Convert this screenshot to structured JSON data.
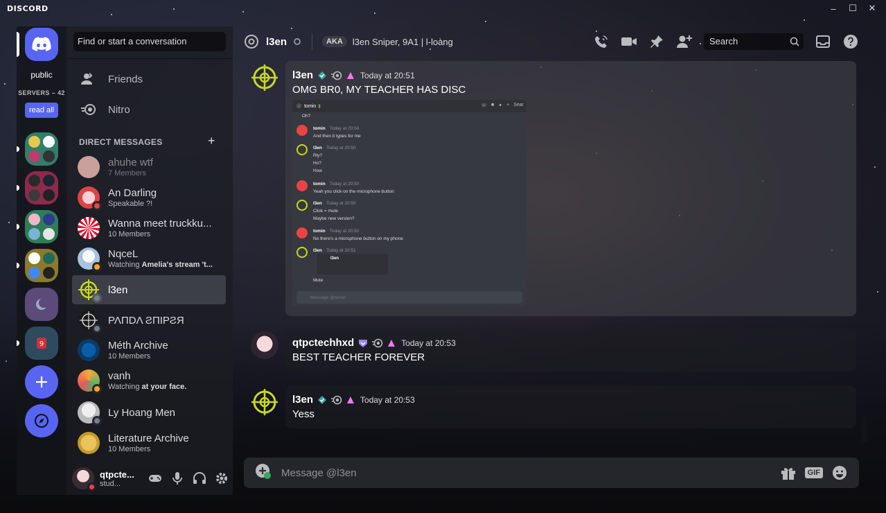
{
  "app": {
    "brand": "DISCORD"
  },
  "rail": {
    "home_label": "public",
    "servers_label": "SERVERS – 42",
    "read_all": "read all"
  },
  "dm_sidebar": {
    "search_placeholder": "Find or start a conversation",
    "nav": [
      {
        "label": "Friends"
      },
      {
        "label": "Nitro"
      }
    ],
    "header": "DIRECT MESSAGES",
    "items": [
      {
        "name": "ahuhe wtf",
        "sub": "7 Members"
      },
      {
        "name": "An Darling",
        "sub": "Speakable ?!"
      },
      {
        "name": "Wanna meet truckku...",
        "sub": "10 Members"
      },
      {
        "name": "NqceL",
        "sub_prefix": "Watching ",
        "sub_bold": "Amelia's stream 't..."
      },
      {
        "name": "l3en",
        "sub": ""
      },
      {
        "name": "ΡΛΠDΛ ƧПIΡƧЯ",
        "sub": ""
      },
      {
        "name": "Méth Archive",
        "sub": "10 Members"
      },
      {
        "name": "vanh",
        "sub_prefix": "Watching ",
        "sub_bold": "at your face."
      },
      {
        "name": "Ly Hoang Men",
        "sub": ""
      },
      {
        "name": "Literature Archive",
        "sub": "10 Members"
      }
    ]
  },
  "user_panel": {
    "name": "qtpcte...",
    "status": "stud..."
  },
  "channel": {
    "name": "l3en",
    "aka_badge": "AKA",
    "aka_text": "l3en Sniper, 9A1 | l-loàng",
    "search_placeholder": "Search"
  },
  "messages": [
    {
      "author": "l3en",
      "time": "Today at 20:51",
      "text": "OMG BR0, MY TEACHER HAS DISC"
    },
    {
      "author": "qtpctechhxd",
      "time": "Today at 20:53",
      "text": "BEST TEACHER FOREVER"
    },
    {
      "author": "l3en",
      "time": "Today at 20:53",
      "text": "Yess"
    }
  ],
  "embed": {
    "header_name": "tomin",
    "header_search": "Sear",
    "lines": [
      {
        "author": "",
        "time": "",
        "texts": [
          "Oh?"
        ]
      },
      {
        "author": "tomin",
        "time": "Today at 20:50",
        "texts": [
          "And then it types for me"
        ]
      },
      {
        "author": "l3en",
        "time": "Today at 20:50",
        "texts": [
          "Rly?",
          "Ho?",
          "How"
        ]
      },
      {
        "author": "tomin",
        "time": "Today at 20:50",
        "texts": [
          "Yeah you click on the microphone button"
        ]
      },
      {
        "author": "l3en",
        "time": "Today at 20:50",
        "texts": [
          "Click = mute",
          "Maybe new version?"
        ]
      },
      {
        "author": "tomin",
        "time": "Today at 20:50",
        "texts": [
          "No there's a microphone button on my phone"
        ]
      },
      {
        "author": "l3en",
        "time": "Today at 20:51",
        "texts": []
      }
    ],
    "mini_name": "l3en",
    "mute_text": "Mute",
    "input_placeholder": "Message @tomin"
  },
  "composer": {
    "placeholder": "Message @l3en",
    "gif": "GIF"
  },
  "colors": {
    "blurple": "#5865f2",
    "dnd": "#ed4245",
    "idle": "#faa61a",
    "online": "#3ba55d",
    "lime": "#c8d820"
  }
}
